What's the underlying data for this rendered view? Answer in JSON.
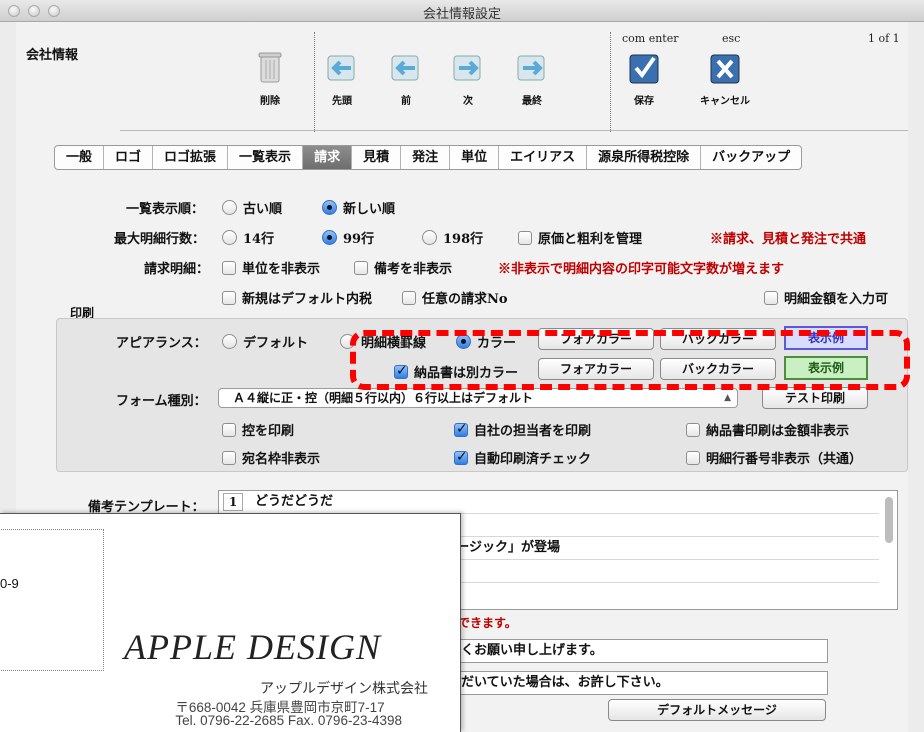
{
  "window": {
    "title": "会社情報設定"
  },
  "header": {
    "section_title": "会社情報",
    "shortcut_enter": "com enter",
    "shortcut_esc": "esc",
    "page_counter": "1 of 1"
  },
  "toolbar": {
    "delete": "削除",
    "first": "先頭",
    "prev": "前",
    "next": "次",
    "last": "最終",
    "save": "保存",
    "cancel": "キャンセル"
  },
  "tabs": [
    "一般",
    "ロゴ",
    "ロゴ拡張",
    "一覧表示",
    "請求",
    "見積",
    "発注",
    "単位",
    "エイリアス",
    "源泉所得税控除",
    "バックアップ"
  ],
  "active_tab": "請求",
  "settings": {
    "list_order_label": "一覧表示順：",
    "list_order_old": "古い順",
    "list_order_new": "新しい順",
    "max_rows_label": "最大明細行数：",
    "rows_14": "14行",
    "rows_99": "99行",
    "rows_198": "198行",
    "manage_cost": "原価と粗利を管理",
    "shared_note": "※請求、見積と発注で共通",
    "detail_label": "請求明細：",
    "hide_unit": "単位を非表示",
    "hide_memo": "備考を非表示",
    "hide_note": "※非表示で明細内容の印字可能文字数が増えます",
    "default_tax": "新規はデフォルト内税",
    "any_invoice_no": "任意の請求No",
    "allow_amount_input": "明細金額を入力可"
  },
  "print": {
    "section_label": "印刷",
    "appearance_label": "アピアランス：",
    "appearance_default": "デフォルト",
    "appearance_lines": "明細横罫線",
    "appearance_color": "カラー",
    "fore_color": "フォアカラー",
    "back_color": "バックカラー",
    "sample": "表示例",
    "delivery_separate_color": "納品書は別カラー",
    "form_type_label": "フォーム種別：",
    "form_type_value": "Ａ４縦に正・控（明細５行以内）６行以上はデフォルト",
    "test_print": "テスト印刷",
    "print_copy": "控を印刷",
    "print_own_staff": "自社の担当者を印刷",
    "delivery_hide_amount": "納品書印刷は金額非表示",
    "hide_address_frame": "宛名枠非表示",
    "auto_printed_check": "自動印刷済チェック",
    "hide_line_numbers": "明細行番号非表示（共通）"
  },
  "memo": {
    "label": "備考テンプレート：",
    "rows": [
      {
        "num": "1",
        "text": "どうだどうだ"
      },
      {
        "num": "",
        "text": ""
      },
      {
        "num": "",
        "text": "イブミュージック」「ホリデーミュージック」が登場"
      },
      {
        "num": "",
        "text": ""
      },
      {
        "num": "",
        "text": ""
      }
    ],
    "register_note": "録できます。"
  },
  "messages": {
    "line1": "ろしくお願い申し上げます。",
    "line2": "いただいていた場合は、お許し下さい。",
    "default_button": "デフォルトメッセージ"
  },
  "overlay": {
    "fragment": "0-9",
    "logo": "APPLE DESIGN",
    "company": "アップルデザイン株式会社",
    "address": "〒668-0042 兵庫県豊岡市京町7-17",
    "phone": "Tel. 0796-22-2685 Fax. 0796-23-4398"
  },
  "colors": {
    "highlight_dash": "#ff0000",
    "note_red": "#c00000",
    "active_tab": "#7a7a7a"
  }
}
